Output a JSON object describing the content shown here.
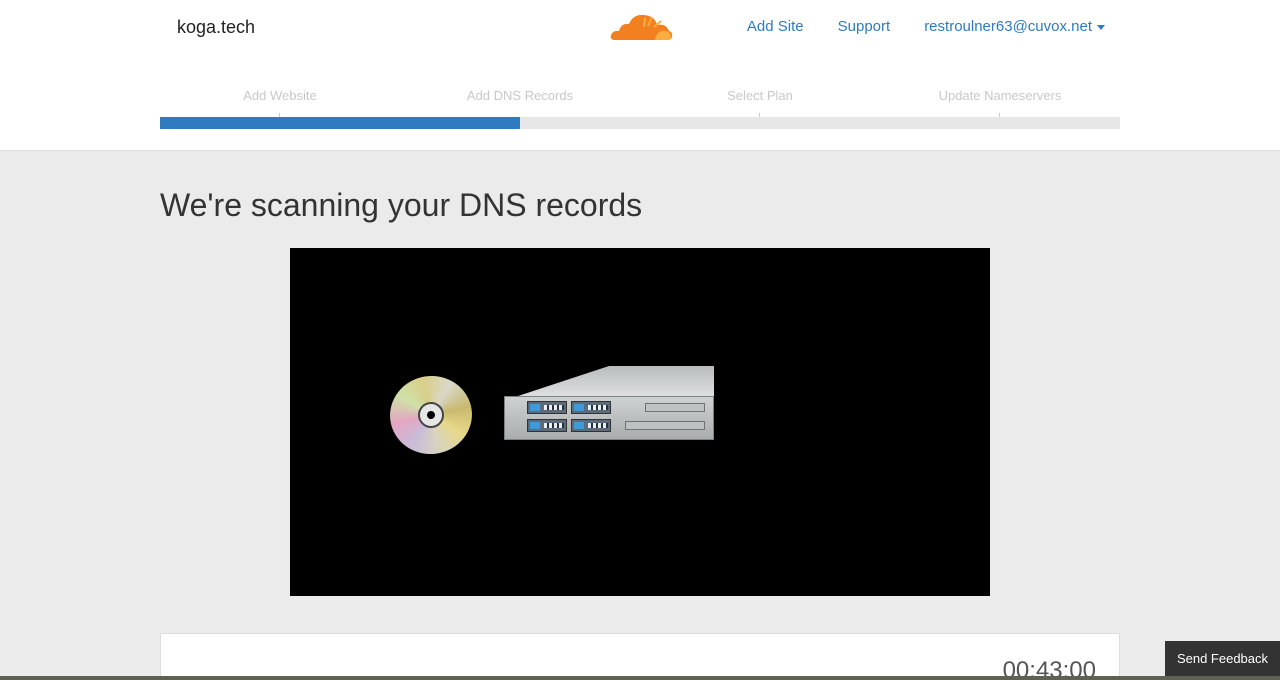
{
  "header": {
    "site_name": "koga.tech",
    "nav": {
      "add_site": "Add Site",
      "support": "Support",
      "account_email": "restroulner63@cuvox.net"
    }
  },
  "steps": {
    "items": [
      "Add Website",
      "Add DNS Records",
      "Select Plan",
      "Update Nameservers"
    ],
    "current_step": 2,
    "progress_fraction": 0.375
  },
  "main": {
    "heading": "We're scanning your DNS records",
    "timer": "00:43:00"
  },
  "feedback": {
    "label": "Send Feedback"
  },
  "colors": {
    "accent": "#2f7bbf",
    "logo_orange": "#f38020"
  }
}
